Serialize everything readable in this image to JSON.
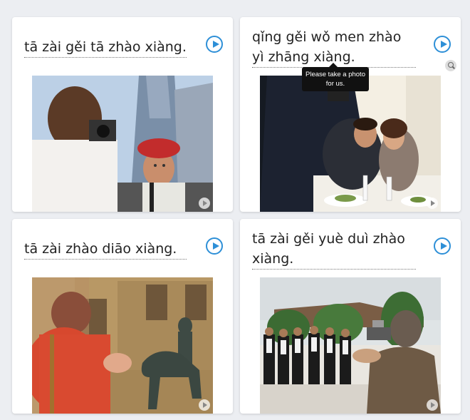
{
  "cards": [
    {
      "phrase": "tā zài gěi tā zhào xiàng."
    },
    {
      "phrase": "qǐng gěi wǒ men zhào yì zhāng xiàng."
    },
    {
      "phrase": "tā zài zhào diāo xiàng."
    },
    {
      "phrase": "tā zài gěi yuè duì zhào xiàng."
    }
  ],
  "tooltip": {
    "text": "Please take a photo for us."
  },
  "icons": {
    "play": "play-audio-icon",
    "zoom": "zoom-icon",
    "corner": "photo-play-icon"
  }
}
